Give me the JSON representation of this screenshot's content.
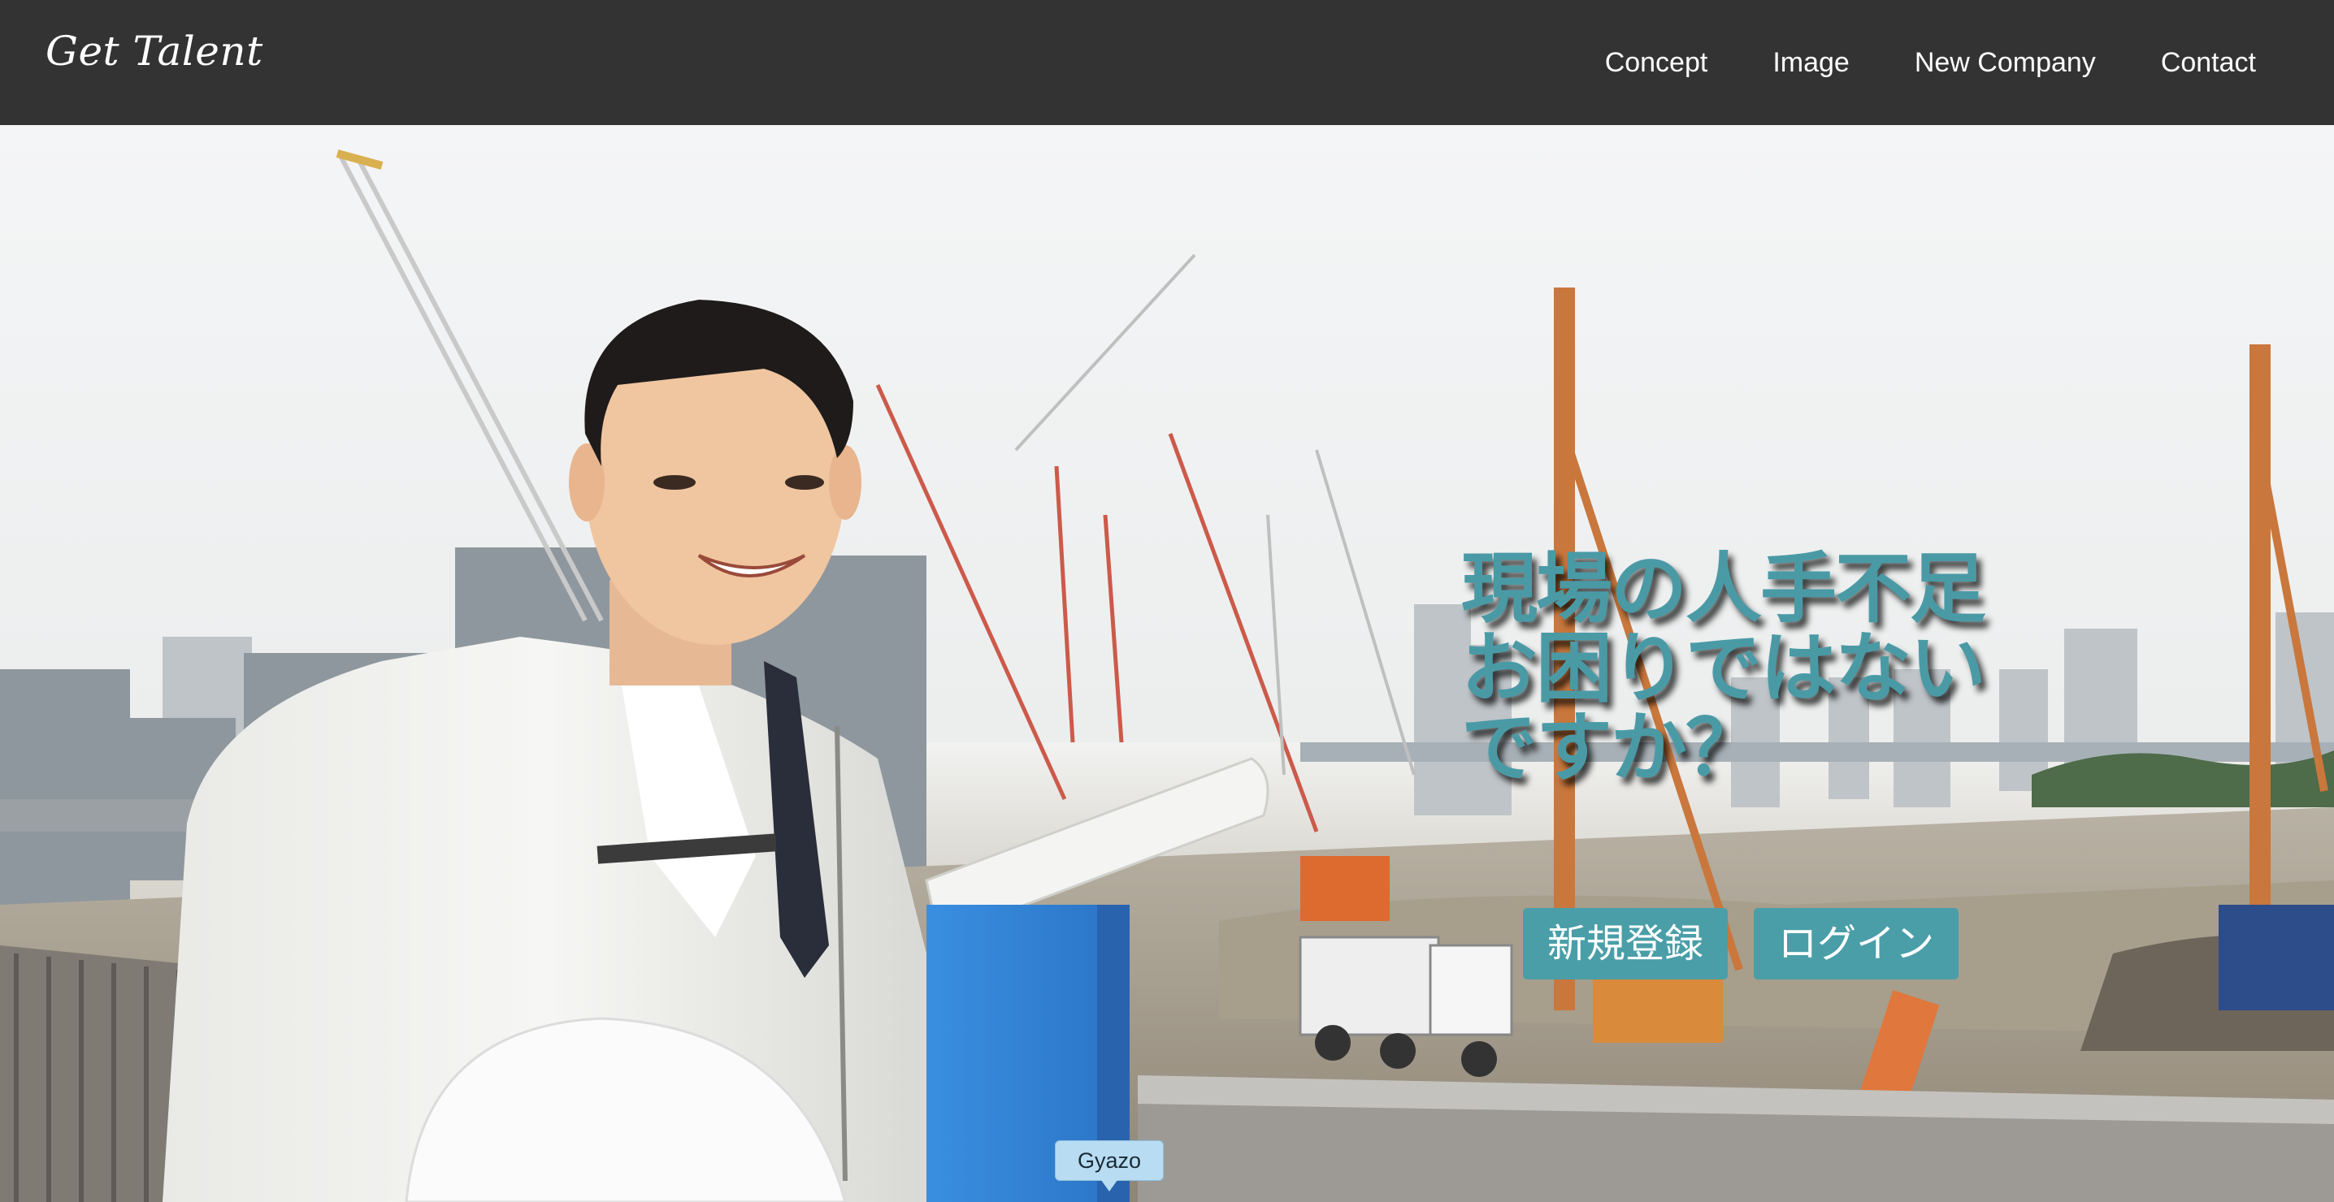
{
  "header": {
    "brand": "Get Talent",
    "nav": [
      {
        "label": "Concept"
      },
      {
        "label": "Image"
      },
      {
        "label": "New Company"
      },
      {
        "label": "Contact"
      }
    ]
  },
  "hero": {
    "headline_lines": [
      "現場の人手不足",
      "お困りではない",
      "ですか？"
    ],
    "buttons": {
      "register_label": "新規登録",
      "login_label": "ログイン"
    }
  },
  "overlay": {
    "gyazo_label": "Gyazo"
  },
  "colors": {
    "header_bg": "#333333",
    "accent": "#4a9ea8",
    "headline": "#4a9aa6"
  }
}
